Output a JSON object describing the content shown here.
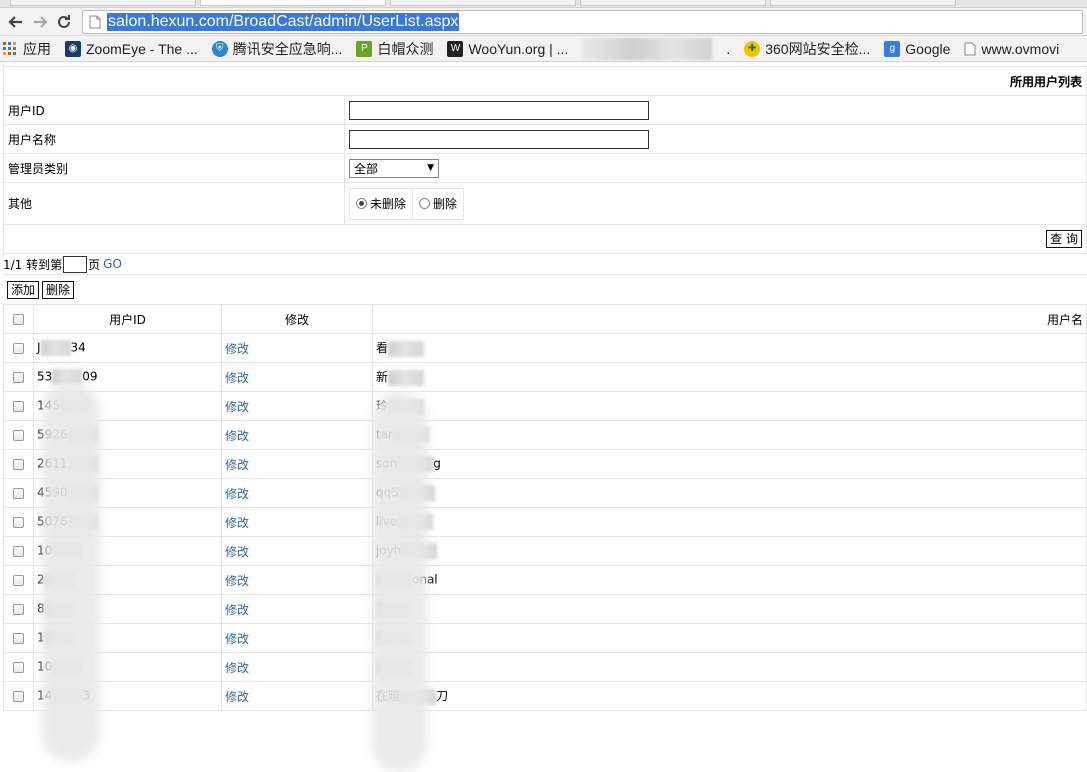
{
  "browser": {
    "url": "salon.hexun.com/BroadCast/admin/UserList.aspx",
    "bookmarks": [
      {
        "label": "应用",
        "icon": "apps-grid-icon"
      },
      {
        "label": "ZoomEye - The ...",
        "icon": "zoomeye-icon"
      },
      {
        "label": "腾讯安全应急响...",
        "icon": "shield-icon"
      },
      {
        "label": "白帽众测",
        "icon": "baimao-icon"
      },
      {
        "label": "WooYun.org | ...",
        "icon": "wooyun-icon"
      },
      {
        "label": ".",
        "icon": "dot"
      },
      {
        "label": "360网站安全检...",
        "icon": "360-icon"
      },
      {
        "label": "Google",
        "icon": "google-icon"
      },
      {
        "label": "www.ovmovi",
        "icon": "page-icon"
      }
    ]
  },
  "form": {
    "title": "所用用户列表",
    "user_id_label": "用户ID",
    "user_name_label": "用户名称",
    "admin_type_label": "管理员类别",
    "admin_type_value": "全部",
    "other_label": "其他",
    "radio_not_deleted": "未删除",
    "radio_deleted": "删除",
    "query_button": "查 询"
  },
  "pager": {
    "status": "1/1 转到第",
    "page_suffix": "页",
    "go": "GO"
  },
  "actions": {
    "add": "添加",
    "delete": "删除"
  },
  "grid": {
    "headers": {
      "user_id": "用户ID",
      "edit": "修改",
      "user_name": "用户名"
    },
    "edit_label": "修改",
    "rows": [
      {
        "id_start": "J",
        "id_end": "34",
        "name": "看",
        "name_end": ""
      },
      {
        "id_start": "53",
        "id_end": "09",
        "name": "新",
        "name_end": ""
      },
      {
        "id_start": "145",
        "id_end": "",
        "name": "玲",
        "name_end": ""
      },
      {
        "id_start": "5926",
        "id_end": "",
        "name": "tar",
        "name_end": ""
      },
      {
        "id_start": "2611",
        "id_end": "",
        "name": "son",
        "name_end": "g"
      },
      {
        "id_start": "4590",
        "id_end": "",
        "name": "qq5",
        "name_end": ""
      },
      {
        "id_start": "5076",
        "id_end": "",
        "name": "live",
        "name_end": ""
      },
      {
        "id_start": "10",
        "id_end": "",
        "name": "joyh",
        "name_end": ""
      },
      {
        "id_start": "2",
        "id_end": "",
        "name": "",
        "name_end": "onal"
      },
      {
        "id_start": "8",
        "id_end": "",
        "name": "",
        "name_end": ""
      },
      {
        "id_start": "1",
        "id_end": "",
        "name": "",
        "name_end": ""
      },
      {
        "id_start": "10",
        "id_end": "",
        "name": "",
        "name_end": ""
      },
      {
        "id_start": "14",
        "id_end": "3",
        "name": "在暗",
        "name_end": "刀"
      }
    ]
  }
}
